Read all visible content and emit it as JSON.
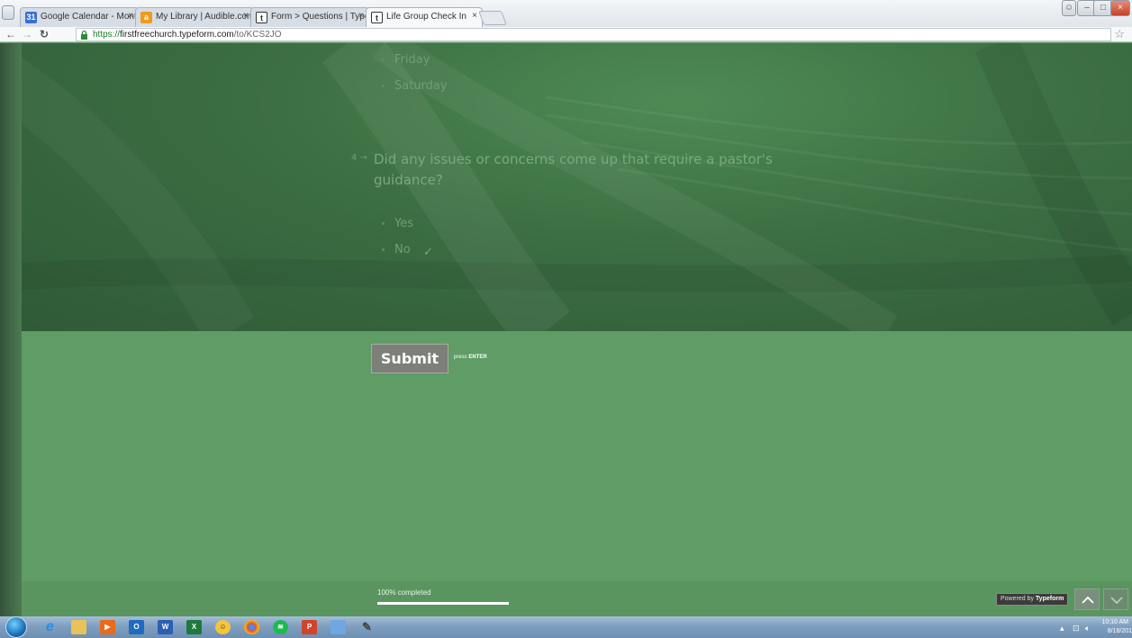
{
  "browser": {
    "tabs": [
      {
        "label": "Google Calendar - Month",
        "icon": "calendar-favicon",
        "color": "#3a6fd8",
        "glyph": "31"
      },
      {
        "label": "My Library | Audible.com",
        "icon": "audible-favicon",
        "color": "#f09a1e",
        "glyph": "a"
      },
      {
        "label": "Form > Questions | Typef",
        "icon": "typeform-favicon",
        "color": "#2b2b2b",
        "glyph": "t"
      },
      {
        "label": "Life Group Check In",
        "icon": "typeform-favicon",
        "color": "#2b2b2b",
        "glyph": "t",
        "active": true
      }
    ],
    "url_scheme": "https://",
    "url_host": "firstfreechurch.typeform.com",
    "url_path": "/to/KCS2JO"
  },
  "form": {
    "prev_options": [
      "Friday",
      "Saturday"
    ],
    "question_number": "4 →",
    "question_text": "Did any issues or concerns come up that require a pastor's guidance?",
    "options": [
      {
        "label": "Yes",
        "selected": false
      },
      {
        "label": "No",
        "selected": true
      }
    ],
    "submit_label": "Submit",
    "hint_prefix": "press",
    "hint_key": "ENTER"
  },
  "footer": {
    "progress_label": "100% completed",
    "progress": 1.0,
    "powered_prefix": "Powered by",
    "powered_brand": "Typeform"
  },
  "taskbar": {
    "apps": [
      "ie-icon",
      "explorer-icon",
      "media-player-icon",
      "outlook-icon",
      "word-icon",
      "excel-icon",
      "messenger-icon",
      "chrome-icon",
      "spotify-icon",
      "powerpoint-icon",
      "remote-desktop-icon",
      "paint-icon"
    ],
    "time": "10:10 AM",
    "date": "8/18/201"
  },
  "colors": {
    "accent_green": "#5f9c66",
    "hero_green": "#3b6e42",
    "submit_gray": "#7d8079"
  }
}
